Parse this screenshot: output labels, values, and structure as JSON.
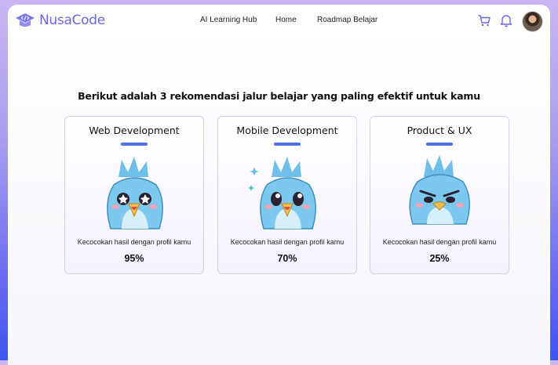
{
  "brand": {
    "name": "NusaCode",
    "logo_icon": "graduation-cap-code-icon"
  },
  "nav": {
    "links": [
      {
        "label": "AI Learning Hub"
      },
      {
        "label": "Home"
      },
      {
        "label": "Roadmap Belajar"
      }
    ],
    "icons": [
      "cart-icon",
      "bell-icon"
    ],
    "avatar": "user-avatar"
  },
  "main": {
    "heading": "Berikut adalah 3 rekomendasi jalur belajar yang paling efektif untuk kamu",
    "cards": [
      {
        "title": "Web Development",
        "match_label": "Kecocokan hasil dengan profil kamu",
        "percent": "95%",
        "mascot": "excited-bird-icon"
      },
      {
        "title": "Mobile Development",
        "match_label": "Kecocokan hasil dengan profil kamu",
        "percent": "70%",
        "mascot": "happy-bird-icon"
      },
      {
        "title": "Product & UX",
        "match_label": "Kecocokan hasil dengan profil kamu",
        "percent": "25%",
        "mascot": "angry-bird-icon"
      }
    ]
  },
  "colors": {
    "accent": "#6a67e8",
    "bar": "#4f6ff0",
    "bird_body": "#7cc8ee",
    "bird_belly": "#d6f0fb",
    "beak": "#f2c14a"
  }
}
